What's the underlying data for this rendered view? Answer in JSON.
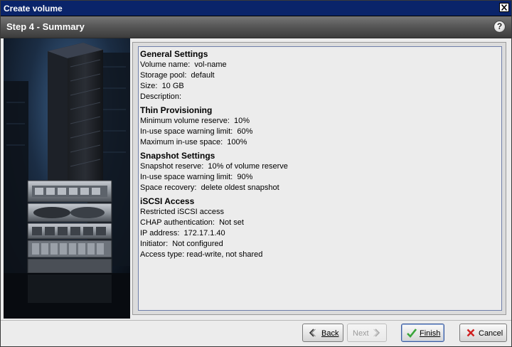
{
  "window": {
    "title": "Create volume"
  },
  "step": {
    "title": "Step 4 - Summary"
  },
  "icons": {
    "help": "help-icon",
    "close": "close-icon",
    "back": "chevron-left-icon",
    "next": "chevron-right-icon",
    "finish": "checkmark-icon",
    "cancel": "x-icon"
  },
  "colors": {
    "titlebar": "#0a246a",
    "finish_check": "#3aa53a",
    "cancel_x": "#d02020"
  },
  "summary": {
    "sections": [
      {
        "title": "General Settings",
        "lines": [
          "Volume name:  vol-name",
          "Storage pool:  default",
          "Size:  10 GB",
          "Description:"
        ]
      },
      {
        "title": "Thin Provisioning",
        "lines": [
          "Minimum volume reserve:  10%",
          "In-use space warning limit:  60%",
          "Maximum in-use space:  100%"
        ]
      },
      {
        "title": "Snapshot Settings",
        "lines": [
          "Snapshot reserve:  10% of volume reserve",
          "In-use space warning limit:  90%",
          "Space recovery:  delete oldest snapshot"
        ]
      },
      {
        "title": "iSCSI Access",
        "lines": [
          "Restricted iSCSI access",
          "CHAP authentication:  Not set",
          "IP address:  172.17.1.40",
          "Initiator:  Not configured",
          "Access type: read-write, not shared"
        ]
      }
    ]
  },
  "buttons": {
    "back": "Back",
    "next": "Next",
    "finish": "Finish",
    "cancel": "Cancel"
  }
}
